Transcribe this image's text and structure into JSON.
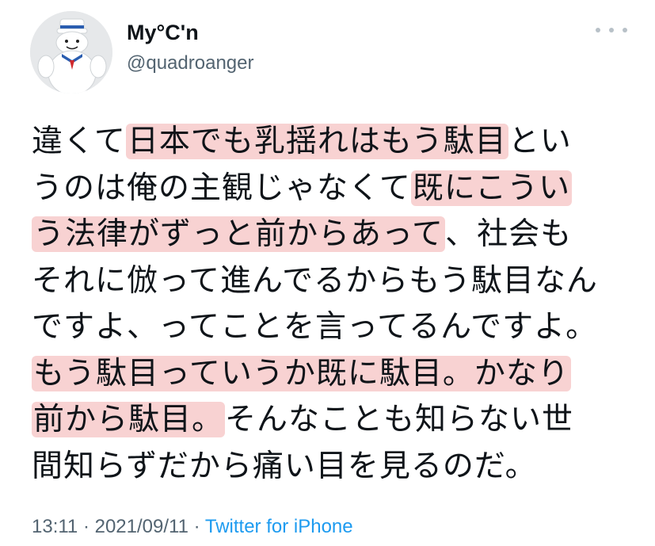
{
  "author": {
    "display_name": "My°C'n",
    "handle": "@quadroanger"
  },
  "tweet": {
    "lines": [
      [
        {
          "t": "違くて",
          "hl": false
        },
        {
          "t": "日本でも乳揺れはもう駄目",
          "hl": true
        },
        {
          "t": "とい",
          "hl": false
        }
      ],
      [
        {
          "t": "うのは俺の主観じゃなくて",
          "hl": false
        },
        {
          "t": "既にこうい",
          "hl": true
        }
      ],
      [
        {
          "t": "う法律がずっと前からあって",
          "hl": true
        },
        {
          "t": "、社会も",
          "hl": false
        }
      ],
      [
        {
          "t": "それに倣って進んでるからもう駄目なん",
          "hl": false
        }
      ],
      [
        {
          "t": "ですよ、ってことを言ってるんですよ。",
          "hl": false
        }
      ],
      [
        {
          "t": "もう駄目っていうか既に駄目。かなり",
          "hl": true
        }
      ],
      [
        {
          "t": "前から駄目。",
          "hl": true
        },
        {
          "t": "そんなことも知らない世",
          "hl": false
        }
      ],
      [
        {
          "t": "間知らずだから痛い目を見るのだ。",
          "hl": false
        }
      ]
    ]
  },
  "meta": {
    "time": "13:11",
    "separator": " · ",
    "date": "2021/09/11",
    "separator2": " · ",
    "source": "Twitter for iPhone"
  },
  "colors": {
    "highlight": "#f8d2d2",
    "link": "#1d9bf0",
    "secondary_text": "#536471"
  },
  "icons": {
    "more": "more-dots-icon",
    "avatar": "marshmallow-mascot-avatar"
  }
}
